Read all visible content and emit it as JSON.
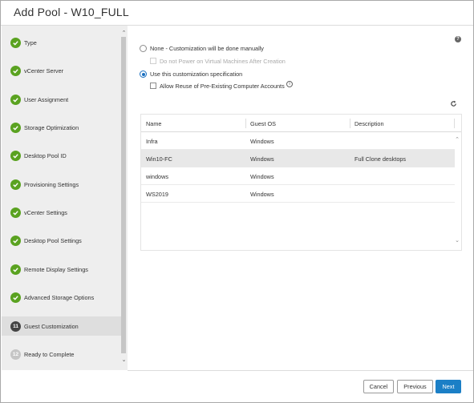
{
  "dialog": {
    "title": "Add Pool - W10_FULL"
  },
  "steps": [
    {
      "label": "Type",
      "state": "done"
    },
    {
      "label": "vCenter Server",
      "state": "done"
    },
    {
      "label": "User Assignment",
      "state": "done"
    },
    {
      "label": "Storage Optimization",
      "state": "done"
    },
    {
      "label": "Desktop Pool ID",
      "state": "done"
    },
    {
      "label": "Provisioning Settings",
      "state": "done"
    },
    {
      "label": "vCenter Settings",
      "state": "done"
    },
    {
      "label": "Desktop Pool Settings",
      "state": "done"
    },
    {
      "label": "Remote Display Settings",
      "state": "done"
    },
    {
      "label": "Advanced Storage Options",
      "state": "done"
    },
    {
      "label": "Guest Customization",
      "state": "current",
      "number": "11"
    },
    {
      "label": "Ready to Complete",
      "state": "pending",
      "number": "12"
    }
  ],
  "customization": {
    "none_label": "None - Customization will be done manually",
    "no_power_on_label": "Do not Power on Virtual Machines After Creation",
    "use_spec_label": "Use this customization specification",
    "allow_reuse_label": "Allow Reuse of Pre-Existing Computer Accounts",
    "selected_option": "use_spec"
  },
  "table": {
    "columns": [
      "Name",
      "Guest OS",
      "Description"
    ],
    "rows": [
      {
        "name": "Infra",
        "guest_os": "Windows",
        "description": ""
      },
      {
        "name": "Win10-FC",
        "guest_os": "Windows",
        "description": "Full Clone desktops",
        "selected": true
      },
      {
        "name": "windows",
        "guest_os": "Windows",
        "description": ""
      },
      {
        "name": "WS2019",
        "guest_os": "Windows",
        "description": ""
      }
    ]
  },
  "icons": {
    "help": "help-icon",
    "info": "info-icon",
    "refresh": "refresh-icon",
    "check": "check-icon"
  },
  "colors": {
    "step_done": "#5aa220",
    "step_current": "#444444",
    "primary_button": "#1b7fc6",
    "radio_selected": "#1a6fc0"
  },
  "buttons": {
    "cancel": "Cancel",
    "previous": "Previous",
    "next": "Next"
  }
}
